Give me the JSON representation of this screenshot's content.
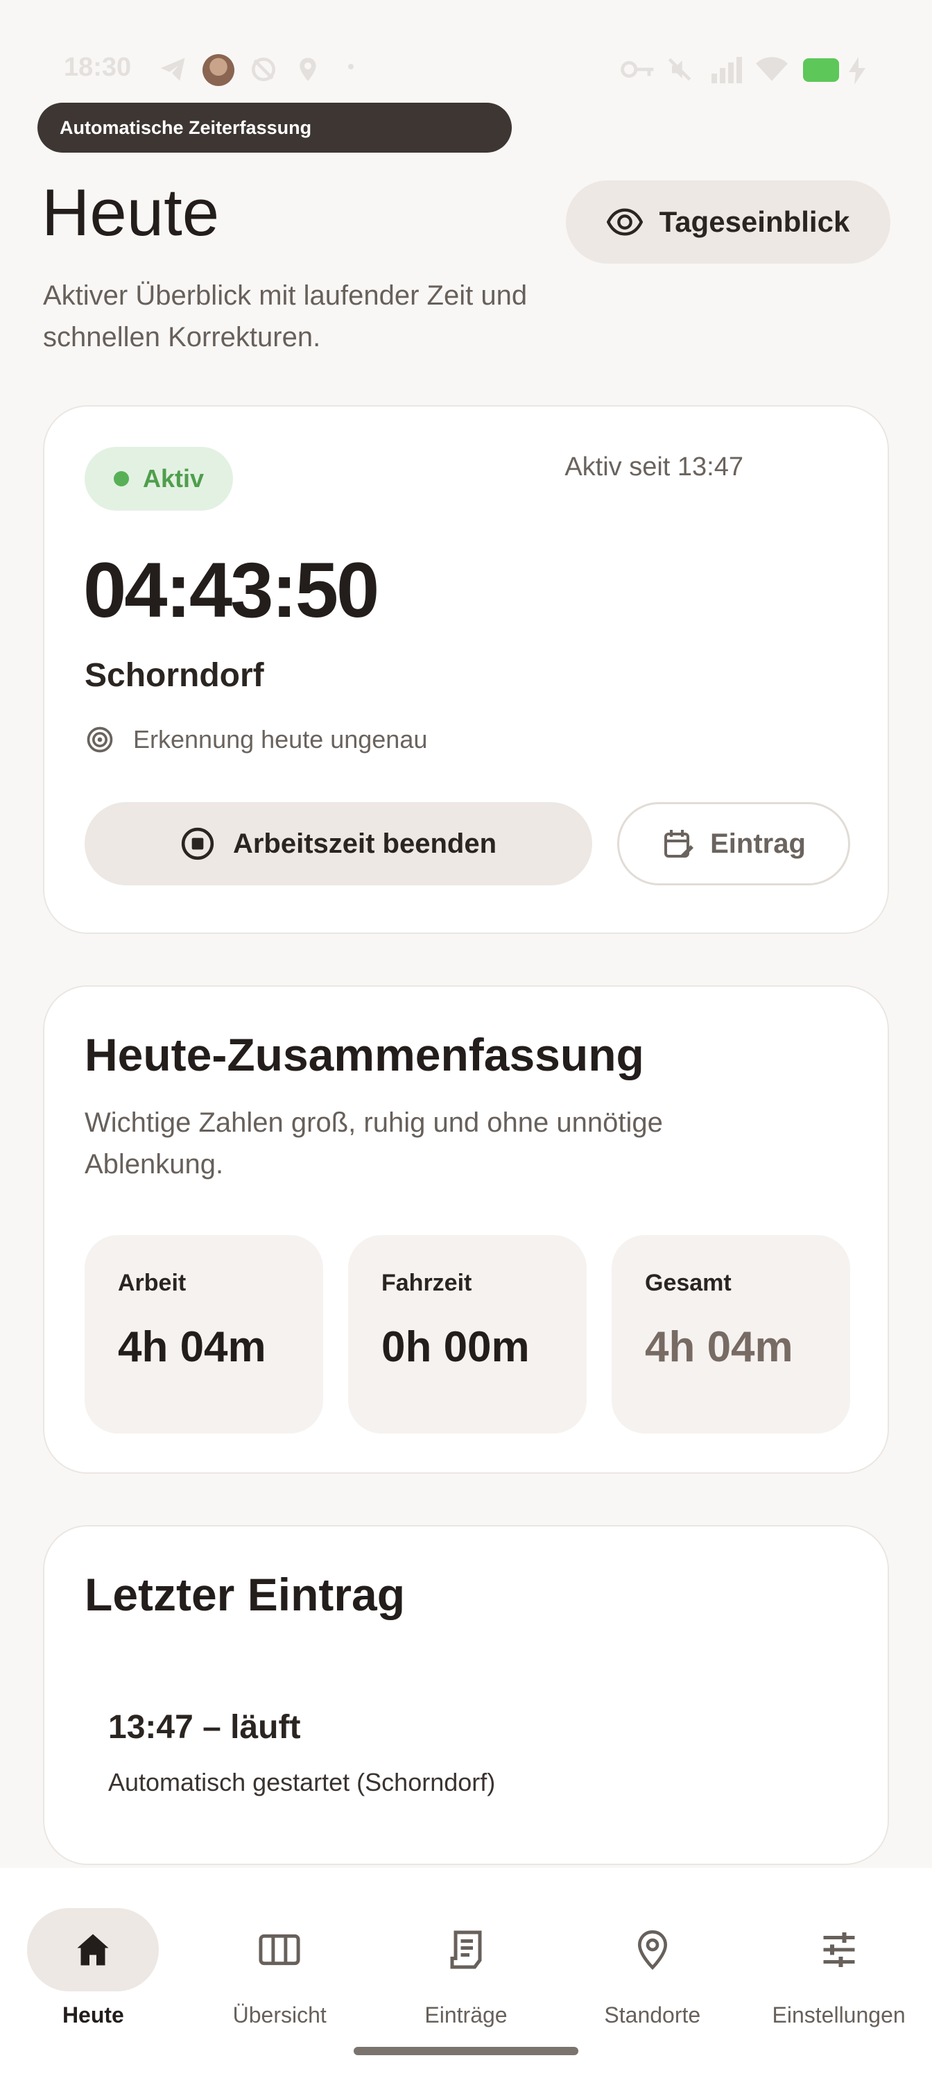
{
  "status_bar": {
    "time": "18:30",
    "icons": [
      "telegram-icon",
      "avatar",
      "location-off-icon",
      "location-icon",
      "dot-icon",
      "key-icon",
      "mute-icon",
      "signal-icon",
      "wifi-icon",
      "battery-icon",
      "charging-icon"
    ],
    "battery_color": "#5dc75a"
  },
  "banner": {
    "label": "Automatische Zeiterfassung"
  },
  "header": {
    "title": "Heute",
    "subtitle": "Aktiver Überblick mit laufender Zeit und schnellen Korrekturen.",
    "insight_button": "Tageseinblick"
  },
  "active_card": {
    "status": "Aktiv",
    "active_since": "Aktiv seit 13:47",
    "timer": "04:43:50",
    "location": "Schorndorf",
    "detection": "Erkennung heute ungenau",
    "end_button": "Arbeitszeit beenden",
    "entry_button": "Eintrag"
  },
  "summary": {
    "title": "Heute-Zusammenfassung",
    "description": "Wichtige Zahlen groß, ruhig und ohne unnötige Ablenkung.",
    "stats": [
      {
        "label": "Arbeit",
        "value": "4h 04m"
      },
      {
        "label": "Fahrzeit",
        "value": "0h 00m"
      },
      {
        "label": "Gesamt",
        "value": "4h 04m"
      }
    ]
  },
  "last_entry": {
    "title": "Letzter Eintrag",
    "time": "13:47 – läuft",
    "description": "Automatisch gestartet (Schorndorf)"
  },
  "nav": {
    "items": [
      {
        "label": "Heute",
        "icon": "home-icon",
        "active": true
      },
      {
        "label": "Übersicht",
        "icon": "columns-icon",
        "active": false
      },
      {
        "label": "Einträge",
        "icon": "receipt-icon",
        "active": false
      },
      {
        "label": "Standorte",
        "icon": "location-pin-icon",
        "active": false
      },
      {
        "label": "Einstellungen",
        "icon": "sliders-icon",
        "active": false
      }
    ]
  },
  "colors": {
    "background": "#f9f7f5",
    "accent_green": "#58b056",
    "banner": "#3d3632",
    "button_fill": "#ede8e4"
  }
}
